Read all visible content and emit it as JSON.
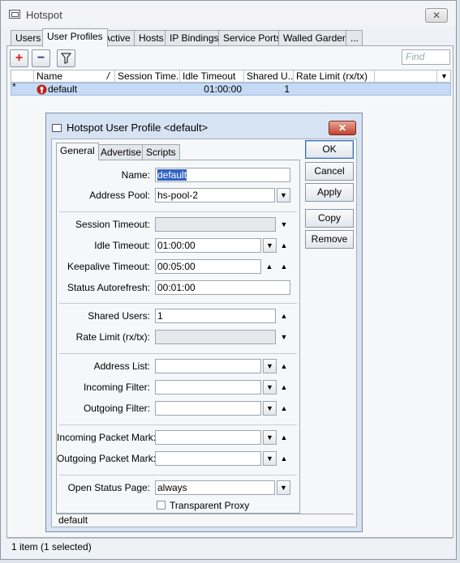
{
  "window": {
    "title": "Hotspot",
    "close": "✕"
  },
  "tabs": [
    "Users",
    "User Profiles",
    "Active",
    "Hosts",
    "IP Bindings",
    "Service Ports",
    "Walled Garden",
    "..."
  ],
  "toolbar": {
    "add": "+",
    "remove": "−",
    "filter": "filter-icon",
    "find_placeholder": "Find"
  },
  "table": {
    "columns": [
      "Name",
      "/",
      "Session Time...",
      "Idle Timeout",
      "Shared U...",
      "Rate Limit (rx/tx)"
    ],
    "rows": [
      {
        "marker": "*",
        "name": "default",
        "session_timeout": "",
        "idle_timeout": "01:00:00",
        "shared_users": "1",
        "rate_limit": ""
      }
    ]
  },
  "status": "1 item (1 selected)",
  "dialog": {
    "title": "Hotspot User Profile <default>",
    "close": "✕",
    "tabs": [
      "General",
      "Advertise",
      "Scripts"
    ],
    "buttons": [
      "OK",
      "Cancel",
      "Apply",
      "Copy",
      "Remove"
    ],
    "labels": {
      "name": "Name:",
      "address_pool": "Address Pool:",
      "session_timeout": "Session Timeout:",
      "idle_timeout": "Idle Timeout:",
      "keepalive_timeout": "Keepalive Timeout:",
      "status_autorefresh": "Status Autorefresh:",
      "shared_users": "Shared Users:",
      "rate_limit": "Rate Limit (rx/tx):",
      "address_list": "Address List:",
      "incoming_filter": "Incoming Filter:",
      "outgoing_filter": "Outgoing Filter:",
      "incoming_packet_mark": "Incoming Packet Mark:",
      "outgoing_packet_mark": "Outgoing Packet Mark:",
      "open_status_page": "Open Status Page:",
      "transparent_proxy": "Transparent Proxy"
    },
    "values": {
      "name": "default",
      "address_pool": "hs-pool-2",
      "session_timeout": "",
      "idle_timeout": "01:00:00",
      "keepalive_timeout": "00:05:00",
      "status_autorefresh": "00:01:00",
      "shared_users": "1",
      "rate_limit": "",
      "address_list": "",
      "incoming_filter": "",
      "outgoing_filter": "",
      "incoming_packet_mark": "",
      "outgoing_packet_mark": "",
      "open_status_page": "always",
      "transparent_proxy": false
    },
    "status": "default"
  },
  "icons": {
    "dropdown": "▼",
    "up": "▲",
    "down": "▼"
  }
}
